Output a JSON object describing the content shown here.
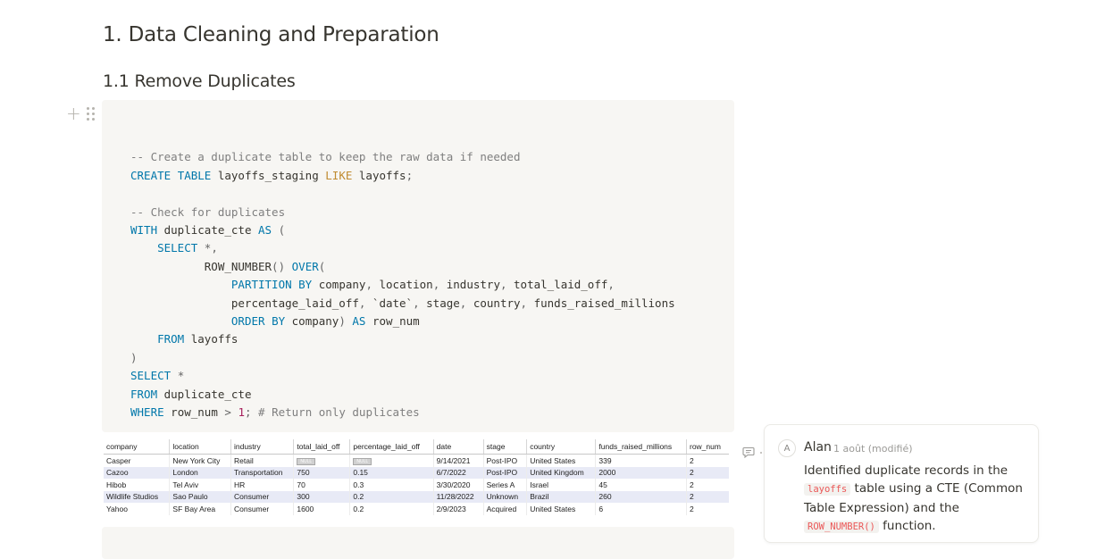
{
  "page": {
    "h1": "1. Data Cleaning and Preparation",
    "h2": "1.1 Remove Duplicates"
  },
  "code_block": {
    "language": "SQL",
    "lines": [
      "",
      "-- Create a duplicate table to keep the raw data if needed",
      "CREATE TABLE layoffs_staging LIKE layoffs;",
      "",
      "-- Check for duplicates",
      "WITH duplicate_cte AS (",
      "    SELECT *,",
      "           ROW_NUMBER() OVER(",
      "               PARTITION BY company, location, industry, total_laid_off,",
      "               percentage_laid_off, `date`, stage, country, funds_raised_millions",
      "               ORDER BY company) AS row_num",
      "    FROM layoffs",
      ")",
      "SELECT *",
      "FROM duplicate_cte",
      "WHERE row_num > 1; # Return only duplicates"
    ]
  },
  "result_table": {
    "columns": [
      "company",
      "location",
      "industry",
      "total_laid_off",
      "percentage_laid_off",
      "date",
      "stage",
      "country",
      "funds_raised_millions",
      "row_num"
    ],
    "rows": [
      [
        "Casper",
        "New York City",
        "Retail",
        "NULL",
        "NULL",
        "9/14/2021",
        "Post-IPO",
        "United States",
        "339",
        "2"
      ],
      [
        "Cazoo",
        "London",
        "Transportation",
        "750",
        "0.15",
        "6/7/2022",
        "Post-IPO",
        "United Kingdom",
        "2000",
        "2"
      ],
      [
        "Hibob",
        "Tel Aviv",
        "HR",
        "70",
        "0.3",
        "3/30/2020",
        "Series A",
        "Israel",
        "45",
        "2"
      ],
      [
        "Wildlife Studios",
        "Sao Paulo",
        "Consumer",
        "300",
        "0.2",
        "11/28/2022",
        "Unknown",
        "Brazil",
        "260",
        "2"
      ],
      [
        "Yahoo",
        "SF Bay Area",
        "Consumer",
        "1600",
        "0.2",
        "2/9/2023",
        "Acquired",
        "United States",
        "6",
        "2"
      ]
    ]
  },
  "comment": {
    "avatar_initial": "A",
    "author": "Alan",
    "timestamp": "1 août (modifié)",
    "text_part1": "Identified duplicate records in the ",
    "code1": "layoffs",
    "text_part2": " table using a CTE (Common Table Expression) and the ",
    "code2": "ROW_NUMBER()",
    "text_part3": " function."
  },
  "icons": {
    "add_block": "plus-icon",
    "drag_handle": "drag-handle-icon",
    "comment": "comment-icon"
  },
  "colors": {
    "code_bg": "#f7f6f3",
    "keyword": "#0077aa",
    "comment_text": "#7f7f7f",
    "function": "#c08b30",
    "number": "#a61e5a",
    "inline_code": "#eb5757",
    "row_stripe": "#e8eaf6"
  }
}
